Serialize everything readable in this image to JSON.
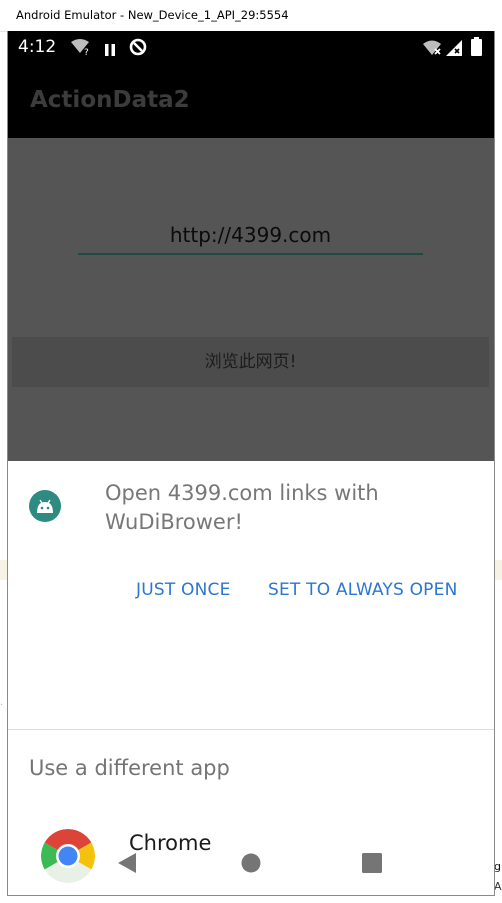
{
  "window": {
    "title": "Android Emulator - New_Device_1_API_29:5554"
  },
  "status_bar": {
    "time": "4:12",
    "icons": [
      "wifi-unknown-icon",
      "pause-icon",
      "sync-circle-icon",
      "wifi-off-icon",
      "signal-icon",
      "battery-icon"
    ]
  },
  "app_bar": {
    "title": "ActionData2"
  },
  "main": {
    "url_value": "http://4399.com",
    "browse_button_label": "浏览此网页!"
  },
  "dialog": {
    "title": "Open 4399.com links with WuDiBrower!",
    "just_once_label": "JUST ONCE",
    "always_label": "SET TO ALWAYS OPEN",
    "different_app_label": "Use a different app",
    "apps": [
      {
        "name": "Chrome",
        "icon": "chrome-icon"
      }
    ]
  },
  "side_notes": {
    "line1": "g",
    "line2": "Ar"
  },
  "colors": {
    "accent": "#2a76d2",
    "scrim": "#555555",
    "underline": "#1f4a44",
    "app_icon_bg": "#2e8b82"
  }
}
